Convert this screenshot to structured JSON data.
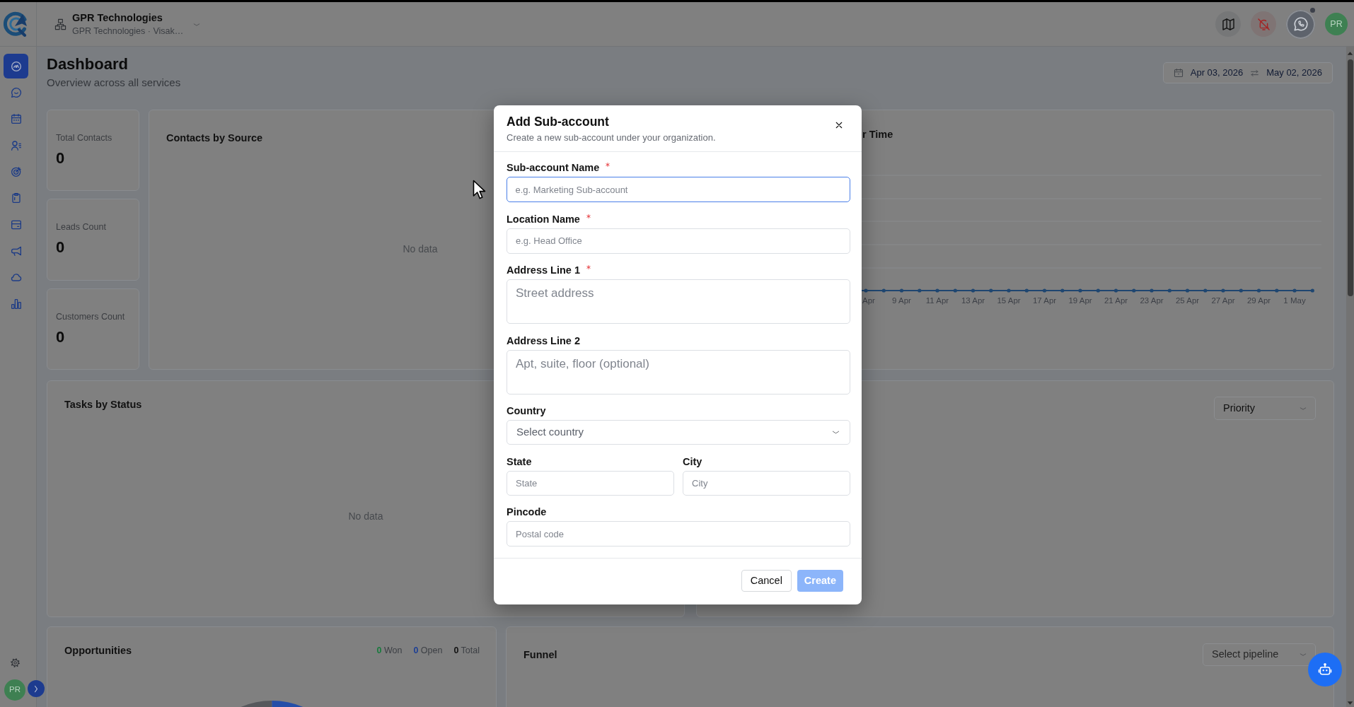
{
  "header": {
    "organization": {
      "name": "GPR Technologies",
      "subtitle": "GPR Technologies · Visak…"
    },
    "actions": [
      {
        "kind": "map",
        "indicator": false
      },
      {
        "kind": "bell-off",
        "indicator": false
      },
      {
        "kind": "chat-phone",
        "indicator": true
      }
    ],
    "avatar": "PR"
  },
  "sidebar": {
    "items": [
      {
        "kind": "gauge",
        "selected": true
      },
      {
        "kind": "chat",
        "selected": false
      },
      {
        "kind": "calendar",
        "selected": false
      },
      {
        "kind": "contacts",
        "selected": false
      },
      {
        "kind": "target",
        "selected": false
      },
      {
        "kind": "clipboard",
        "selected": false
      },
      {
        "kind": "card",
        "selected": false
      },
      {
        "kind": "megaphone",
        "selected": false
      },
      {
        "kind": "cloud",
        "selected": false
      },
      {
        "kind": "bar-chart",
        "selected": false
      }
    ],
    "footer_avatar": "PR"
  },
  "page": {
    "title": "Dashboard",
    "subtitle": "Overview across all services",
    "date_range": {
      "start": "Apr 03, 2026",
      "end": "May 02, 2026"
    }
  },
  "stat_cards": [
    {
      "label": "Total Contacts",
      "value": "0"
    },
    {
      "label": "Leads Count",
      "value": "0"
    },
    {
      "label": "Customers Count",
      "value": "0"
    }
  ],
  "contacts_by_source": {
    "title": "Contacts by Source",
    "empty_text": "No data"
  },
  "time_chart": {
    "title": "r Time",
    "x_labels": [
      "Apr",
      "9 Apr",
      "11 Apr",
      "13 Apr",
      "15 Apr",
      "17 Apr",
      "19 Apr",
      "21 Apr",
      "23 Apr",
      "25 Apr",
      "27 Apr",
      "29 Apr",
      "1 May"
    ]
  },
  "tasks_by_status": {
    "title": "Tasks by Status",
    "empty_text": "No data"
  },
  "card_4": {
    "dropdown": "Priority"
  },
  "opportunities": {
    "title": "Opportunities",
    "counts": [
      {
        "text": "**0** Won",
        "color": "#177a3c"
      },
      {
        "text": "**0** Open",
        "color": "#1d3f94"
      },
      {
        "text": "**0** Total",
        "color": "#111111"
      }
    ]
  },
  "funnel": {
    "title": "Funnel",
    "dropdown": "Select pipeline"
  },
  "modal": {
    "title": "Add Sub-account",
    "subtitle": "Create a new sub-account under your organization.",
    "field_rows": [
      [
        {
          "label": "Sub-account Name",
          "required": true,
          "kind": "input",
          "placeholder": "e.g. Marketing Sub-account",
          "focused": true
        }
      ],
      [
        {
          "label": "Location Name",
          "required": true,
          "kind": "input",
          "placeholder": "e.g. Head Office",
          "focused": false
        }
      ],
      [
        {
          "label": "Address Line 1",
          "required": true,
          "kind": "textarea",
          "placeholder": "Street address",
          "focused": false
        }
      ],
      [
        {
          "label": "Address Line 2",
          "required": false,
          "kind": "textarea",
          "placeholder": "Apt, suite, floor (optional)",
          "focused": false
        }
      ],
      [
        {
          "label": "Country",
          "required": false,
          "kind": "select",
          "placeholder": "Select country",
          "focused": false
        }
      ],
      [
        {
          "label": "State",
          "required": false,
          "kind": "input",
          "placeholder": "State",
          "focused": false
        },
        {
          "label": "City",
          "required": false,
          "kind": "input",
          "placeholder": "City",
          "focused": false
        }
      ],
      [
        {
          "label": "Pincode",
          "required": false,
          "kind": "input",
          "placeholder": "Postal code",
          "focused": false
        }
      ]
    ],
    "buttons": [
      {
        "label": "Cancel",
        "kind": "secondary",
        "disabled": false
      },
      {
        "label": "Create",
        "kind": "primary",
        "disabled": true
      }
    ]
  }
}
